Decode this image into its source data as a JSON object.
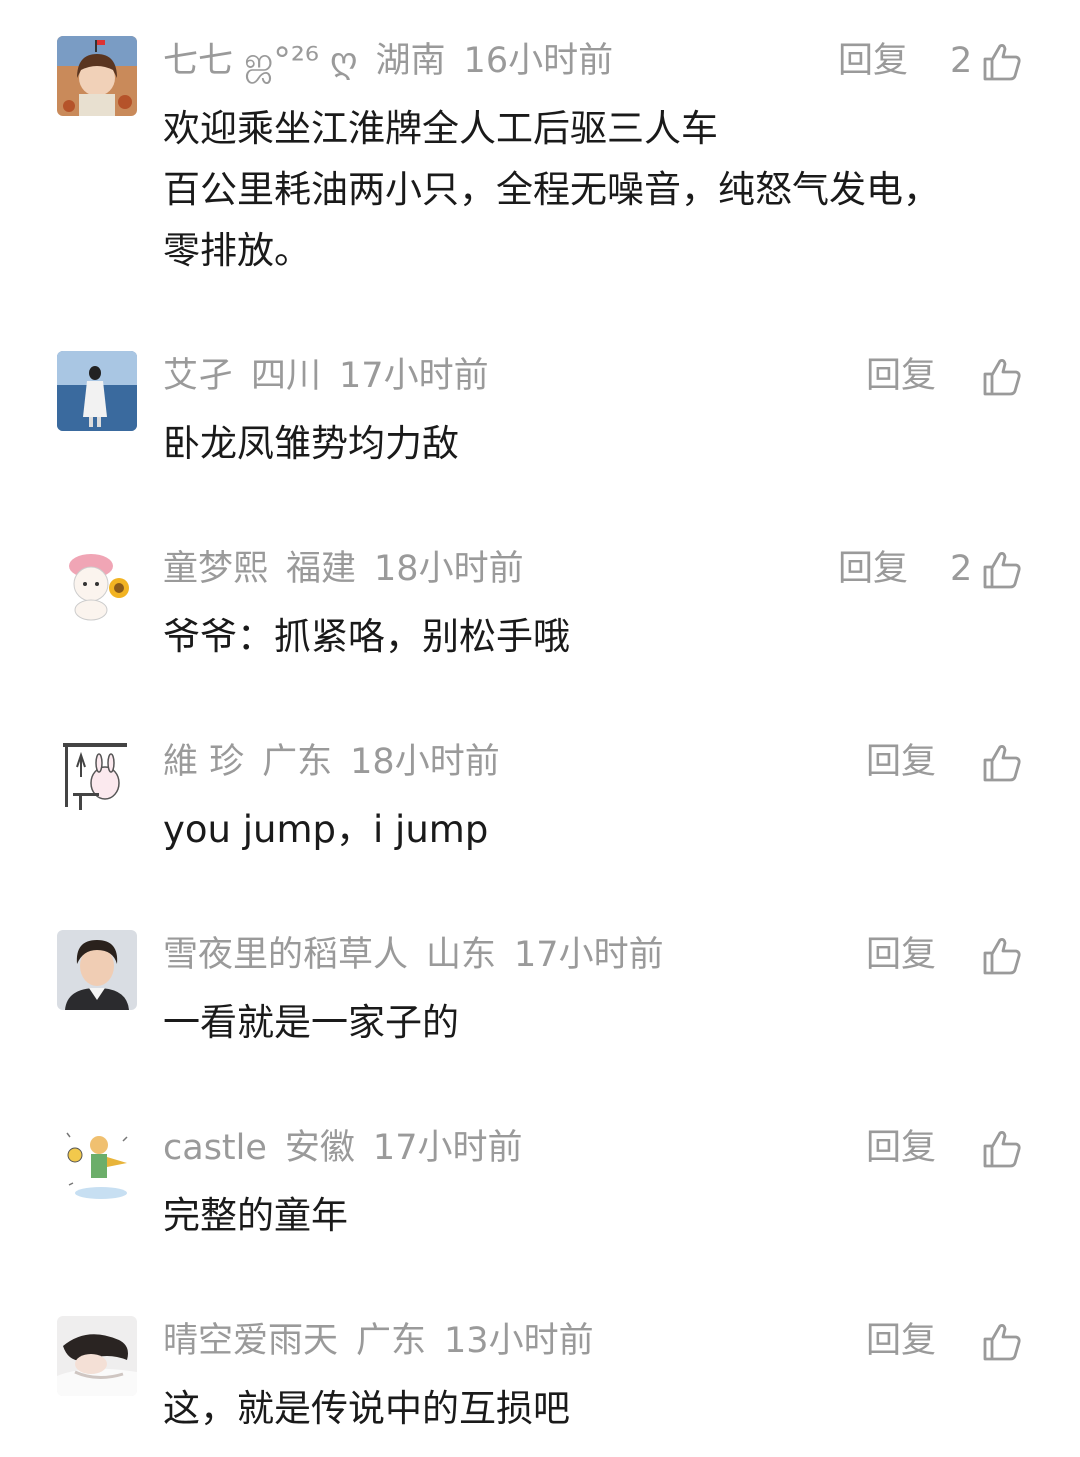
{
  "reply_label": "回复",
  "comments": [
    {
      "username": "七七 ஜ°²⁶ ღ",
      "location": "湖南",
      "time": "16小时前",
      "likes": "2",
      "lines": [
        "欢迎乘坐江淮牌全人工后驱三人车",
        "百公里耗油两小只，全程无噪音，纯怒气发电，",
        "零排放。"
      ],
      "avatar": "avatar-girl-autumn"
    },
    {
      "username": "艾孑",
      "location": "四川",
      "time": "17小时前",
      "likes": "",
      "lines": [
        "卧龙凤雏势均力敌"
      ],
      "avatar": "avatar-lake-figure"
    },
    {
      "username": "童梦熙",
      "location": "福建",
      "time": "18小时前",
      "likes": "2",
      "lines": [
        "爷爷：抓紧咯，别松手哦"
      ],
      "avatar": "avatar-cartoon-sunflower"
    },
    {
      "username": "維 珍",
      "location": "广东",
      "time": "18小时前",
      "likes": "",
      "lines": [
        "you jump，i jump"
      ],
      "avatar": "avatar-cartoon-bunny"
    },
    {
      "username": "雪夜里的稻草人",
      "location": "山东",
      "time": "17小时前",
      "likes": "",
      "lines": [
        "一看就是一家子的"
      ],
      "avatar": "avatar-young-man"
    },
    {
      "username": "castle",
      "location": "安徽",
      "time": "17小时前",
      "likes": "",
      "lines": [
        "完整的童年"
      ],
      "avatar": "avatar-little-prince"
    },
    {
      "username": "晴空爱雨天",
      "location": "广东",
      "time": "13小时前",
      "likes": "",
      "lines": [
        "这，就是传说中的互损吧"
      ],
      "avatar": "avatar-girl-lying"
    }
  ],
  "icons": {
    "like": "thumbs-up-icon"
  }
}
